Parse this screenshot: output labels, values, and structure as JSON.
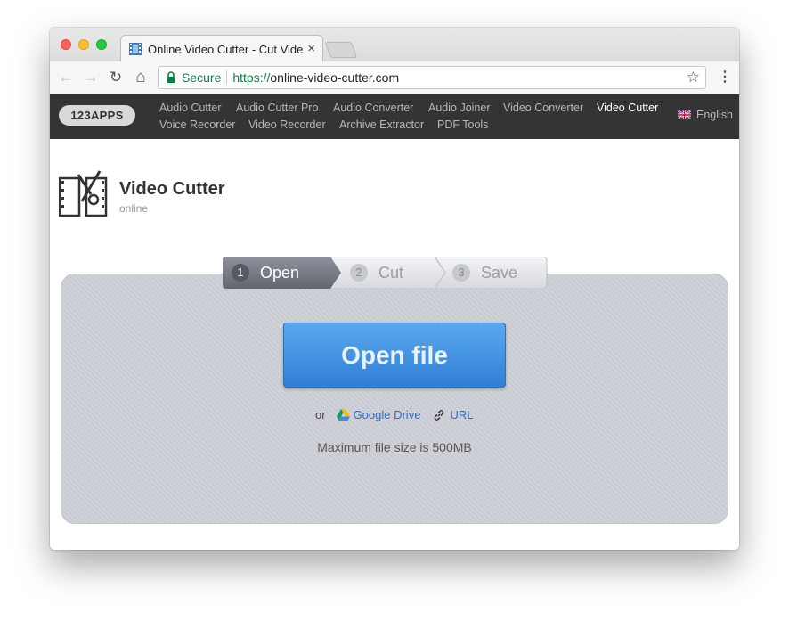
{
  "browser": {
    "tab_title": "Online Video Cutter - Cut Vide",
    "tab_close": "×",
    "secure_label": "Secure",
    "url_scheme": "https://",
    "url_host": "online-video-cutter.com",
    "back_icon": "←",
    "forward_icon": "→",
    "reload_icon": "↻",
    "home_icon": "⌂",
    "star_icon": "☆",
    "menu_icon": "⋮"
  },
  "sitenav": {
    "logo": "123APPS",
    "links_row1": [
      "Audio Cutter",
      "Audio Cutter Pro",
      "Audio Converter",
      "Audio Joiner",
      "Video Converter",
      "Video Cutter"
    ],
    "links_row2": [
      "Voice Recorder",
      "Video Recorder",
      "Archive Extractor",
      "PDF Tools"
    ],
    "current": "Video Cutter",
    "language": "English"
  },
  "app": {
    "title": "Video Cutter",
    "subtitle": "online"
  },
  "steps": [
    {
      "number": "1",
      "label": "Open"
    },
    {
      "number": "2",
      "label": "Cut"
    },
    {
      "number": "3",
      "label": "Save"
    }
  ],
  "upload": {
    "open_button": "Open file",
    "or_label": "or",
    "google_drive": "Google Drive",
    "url": "URL",
    "max_size": "Maximum file size is 500MB"
  },
  "colors": {
    "accent": "#2f7fd6",
    "secure": "#0b8043",
    "nav_bg": "#343434",
    "link": "#2b6cc4"
  }
}
